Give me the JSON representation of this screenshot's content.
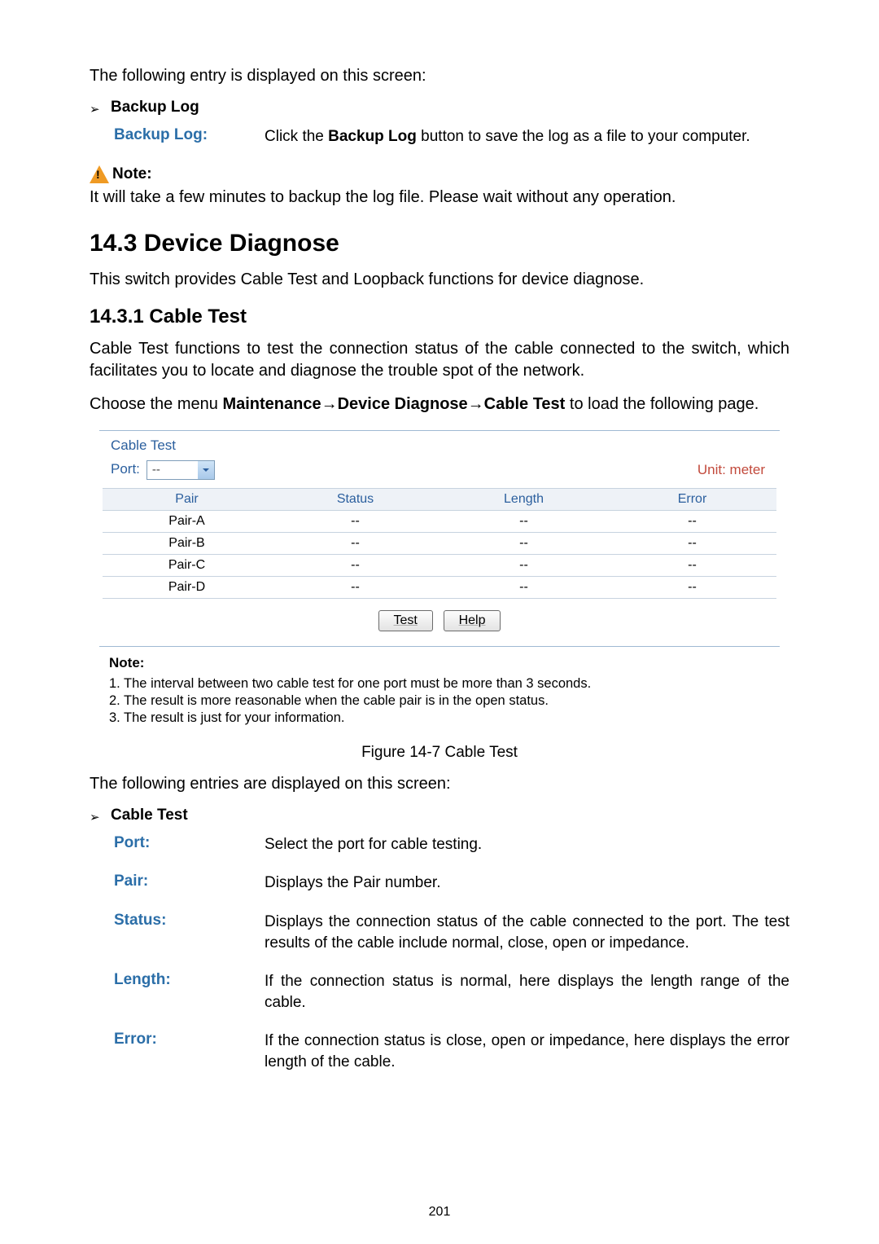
{
  "intro1": "The following entry is displayed on this screen:",
  "backup": {
    "heading": "Backup Log",
    "term": "Backup Log:",
    "desc_prefix": "Click the ",
    "desc_bold": "Backup Log",
    "desc_suffix": " button to save the log as a file to your computer."
  },
  "note1": {
    "label": "Note:",
    "text": "It will take a few minutes to backup the log file. Please wait without any operation."
  },
  "h2": "14.3 Device Diagnose",
  "h2_para": "This switch provides Cable Test and Loopback functions for device diagnose.",
  "h3": "14.3.1  Cable Test",
  "h3_para": "Cable Test functions to test the connection status of the cable connected to the switch, which facilitates you to locate and diagnose the trouble spot of the network.",
  "menu_path": {
    "prefix": "Choose the menu ",
    "b1": "Maintenance",
    "arrow": "→",
    "b2": "Device Diagnose",
    "b3": "Cable Test",
    "suffix": " to load the following page."
  },
  "panel": {
    "title": "Cable Test",
    "port_label": "Port:",
    "port_value": "--",
    "unit": "Unit: meter",
    "headers": {
      "pair": "Pair",
      "status": "Status",
      "length": "Length",
      "error": "Error"
    },
    "rows": [
      {
        "pair": "Pair-A",
        "status": "--",
        "length": "--",
        "error": "--"
      },
      {
        "pair": "Pair-B",
        "status": "--",
        "length": "--",
        "error": "--"
      },
      {
        "pair": "Pair-C",
        "status": "--",
        "length": "--",
        "error": "--"
      },
      {
        "pair": "Pair-D",
        "status": "--",
        "length": "--",
        "error": "--"
      }
    ],
    "btn_test": "Test",
    "btn_help": "Help"
  },
  "panel_note": {
    "hd": "Note:",
    "i1": "1. The interval between two cable test for one port must be more than 3 seconds.",
    "i2": "2. The result is more reasonable when the cable pair is in the open status.",
    "i3": "3. The result is just for your information."
  },
  "caption": "Figure 14-7 Cable Test",
  "intro2": "The following entries are displayed on this screen:",
  "ct_heading": "Cable Test",
  "defs": {
    "port": {
      "t": "Port:",
      "d": "Select the port for cable testing."
    },
    "pair": {
      "t": "Pair:",
      "d": "Displays the Pair number."
    },
    "status": {
      "t": "Status:",
      "d": "Displays the connection status of the cable connected to the port. The test results of the cable include normal, close, open or impedance."
    },
    "length": {
      "t": "Length:",
      "d": "If the connection status is normal, here displays the length range of the cable."
    },
    "error": {
      "t": "Error:",
      "d": "If the connection status is close, open or impedance, here displays the error length of the cable."
    }
  },
  "page_num": "201"
}
